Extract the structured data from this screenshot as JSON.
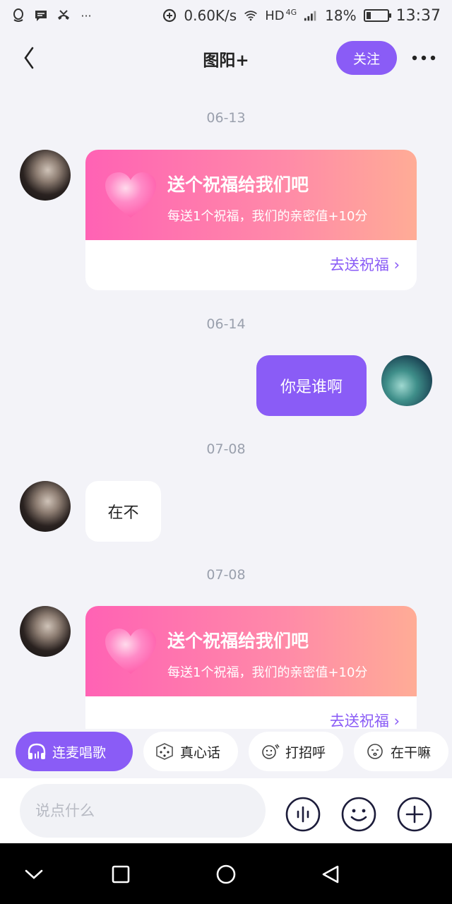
{
  "status_bar": {
    "left_icons": [
      "qq-icon",
      "message-icon",
      "missed-call-icon",
      "more-dots-icon"
    ],
    "speed": "0.60K/s",
    "network": "HD",
    "network_gen": "4G",
    "battery": "18%",
    "time": "13:37"
  },
  "header": {
    "title": "图阳+",
    "follow_label": "关注"
  },
  "messages": {
    "ts1": "06-13",
    "gift1": {
      "title": "送个祝福给我们吧",
      "subtitle": "每送1个祝福，我们的亲密值+10分",
      "link": "去送祝福 ›"
    },
    "ts2": "06-14",
    "sent_text": "你是谁啊",
    "ts3": "07-08",
    "received_text": "在不",
    "ts4": "07-08",
    "gift2": {
      "title": "送个祝福给我们吧",
      "subtitle": "每送1个祝福，我们的亲密值+10分",
      "link": "去送祝福 ›"
    }
  },
  "quick_actions": {
    "sing": "连麦唱歌",
    "truth": "真心话",
    "greet": "打招呼",
    "doing": "在干嘛"
  },
  "input": {
    "placeholder": "说点什么"
  },
  "colors": {
    "accent": "#8a5cf6",
    "gift_gradient_start": "#ff62b4",
    "gift_gradient_end": "#ffac96",
    "background": "#f3f3f8"
  }
}
